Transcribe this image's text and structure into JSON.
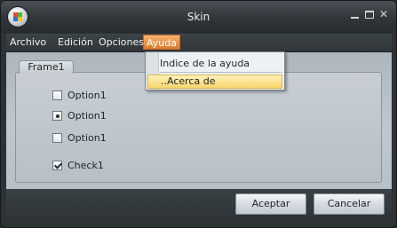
{
  "window": {
    "title": "Skin"
  },
  "menubar": {
    "items": [
      {
        "label": "Archivo"
      },
      {
        "label": "Edición"
      },
      {
        "label": "Opciones"
      },
      {
        "label": "Ayuda",
        "active": true
      }
    ]
  },
  "dropdown": {
    "items": [
      {
        "label": "Indice de la ayuda"
      },
      {
        "label": "..Acerca de",
        "highlighted": true
      }
    ]
  },
  "frame": {
    "label": "Frame1",
    "controls": [
      {
        "type": "checkbox",
        "label": "Option1",
        "checked": false
      },
      {
        "type": "radio",
        "label": "Option1",
        "selected": true
      },
      {
        "type": "checkbox",
        "label": "Option1",
        "checked": false
      },
      {
        "type": "checkbox",
        "label": "Check1",
        "checked": true
      }
    ]
  },
  "buttons": {
    "ok": "Aceptar",
    "cancel": "Cancelar"
  },
  "colors": {
    "menu_active": "#e07a2c",
    "highlight": "#f7d66e",
    "panel": "#c0c7ce"
  }
}
